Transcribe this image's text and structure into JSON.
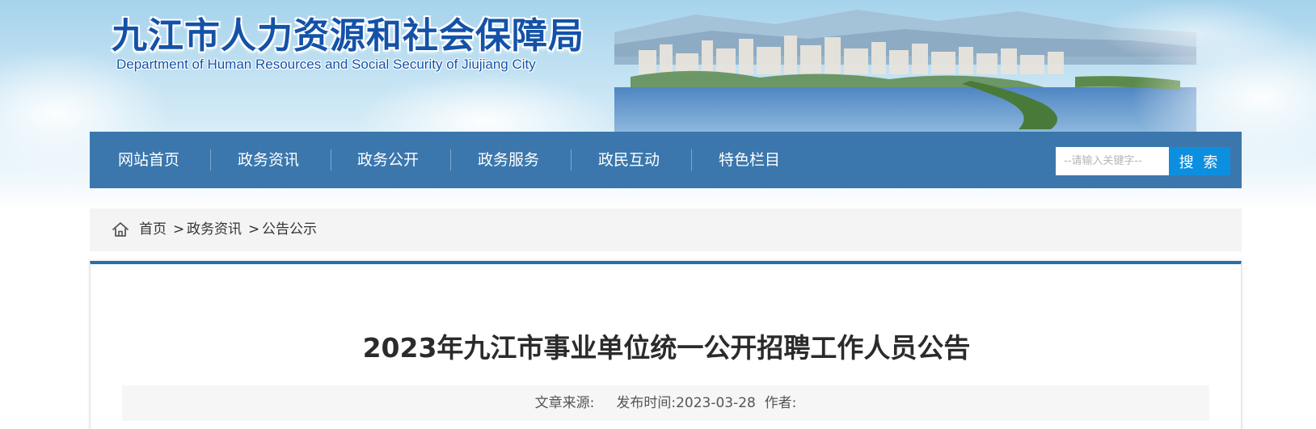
{
  "header": {
    "title": "九江市人力资源和社会保障局",
    "subtitle": "Department of Human Resources and Social Security of Jiujiang City",
    "banner_image": "city-lake-panorama"
  },
  "nav": {
    "items": [
      {
        "label": "网站首页"
      },
      {
        "label": "政务资讯"
      },
      {
        "label": "政务公开"
      },
      {
        "label": "政务服务"
      },
      {
        "label": "政民互动"
      },
      {
        "label": "特色栏目"
      }
    ],
    "search_placeholder": "--请输入关键字--",
    "search_button": "搜 索",
    "bg_color": "#3b77ad",
    "button_color": "#0d8fe0"
  },
  "breadcrumb": {
    "icon": "home-icon",
    "items": [
      "首页",
      "政务资讯",
      "公告公示"
    ],
    "separator": ">"
  },
  "article": {
    "title": "2023年九江市事业单位统一公开招聘工作人员公告",
    "source_label": "文章来源:",
    "date_label": "发布时间:",
    "date": "2023-03-28",
    "author_label": "作者:",
    "accent_color": "#276eae"
  }
}
